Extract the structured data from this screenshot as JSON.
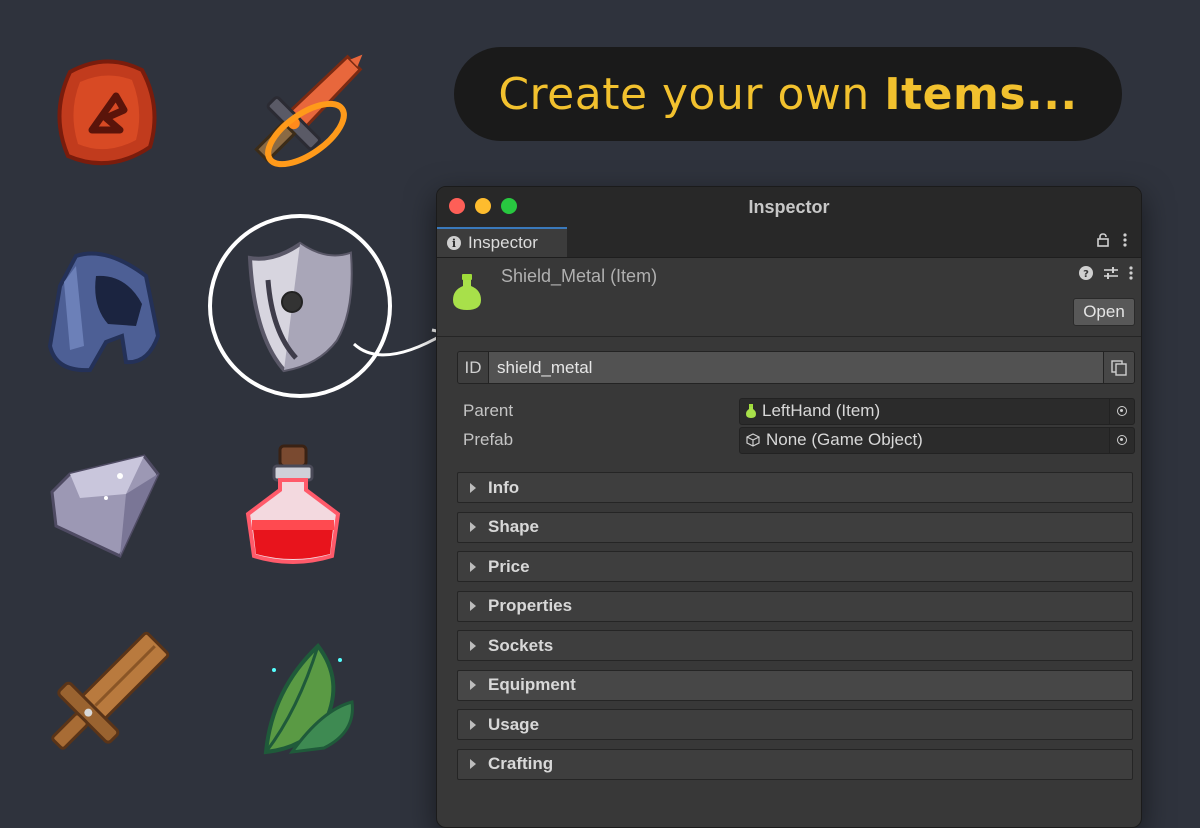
{
  "banner": {
    "text_regular": "Create your own ",
    "text_bold": "Items..."
  },
  "icons": [
    "rune-stone-icon",
    "flaming-sword-icon",
    "helmet-icon",
    "shield-icon",
    "crystal-stone-icon",
    "red-potion-icon",
    "wooden-sword-icon",
    "herb-leaf-icon"
  ],
  "window": {
    "title": "Inspector",
    "tab_label": "Inspector",
    "item_name": "Shield_Metal (Item)",
    "open_label": "Open",
    "id": {
      "label": "ID",
      "value": "shield_metal"
    },
    "fields": [
      {
        "label": "Parent",
        "value": "LeftHand (Item)",
        "icon": "potion-icon"
      },
      {
        "label": "Prefab",
        "value": "None (Game Object)",
        "icon": "cube-icon"
      }
    ],
    "sections": [
      "Info",
      "Shape",
      "Price",
      "Properties",
      "Sockets",
      "Equipment",
      "Usage",
      "Crafting"
    ]
  },
  "colors": {
    "background": "#2f333d",
    "banner_text": "#f2c12e",
    "window_bg": "#383838",
    "accent_tab": "#3a79bb"
  }
}
